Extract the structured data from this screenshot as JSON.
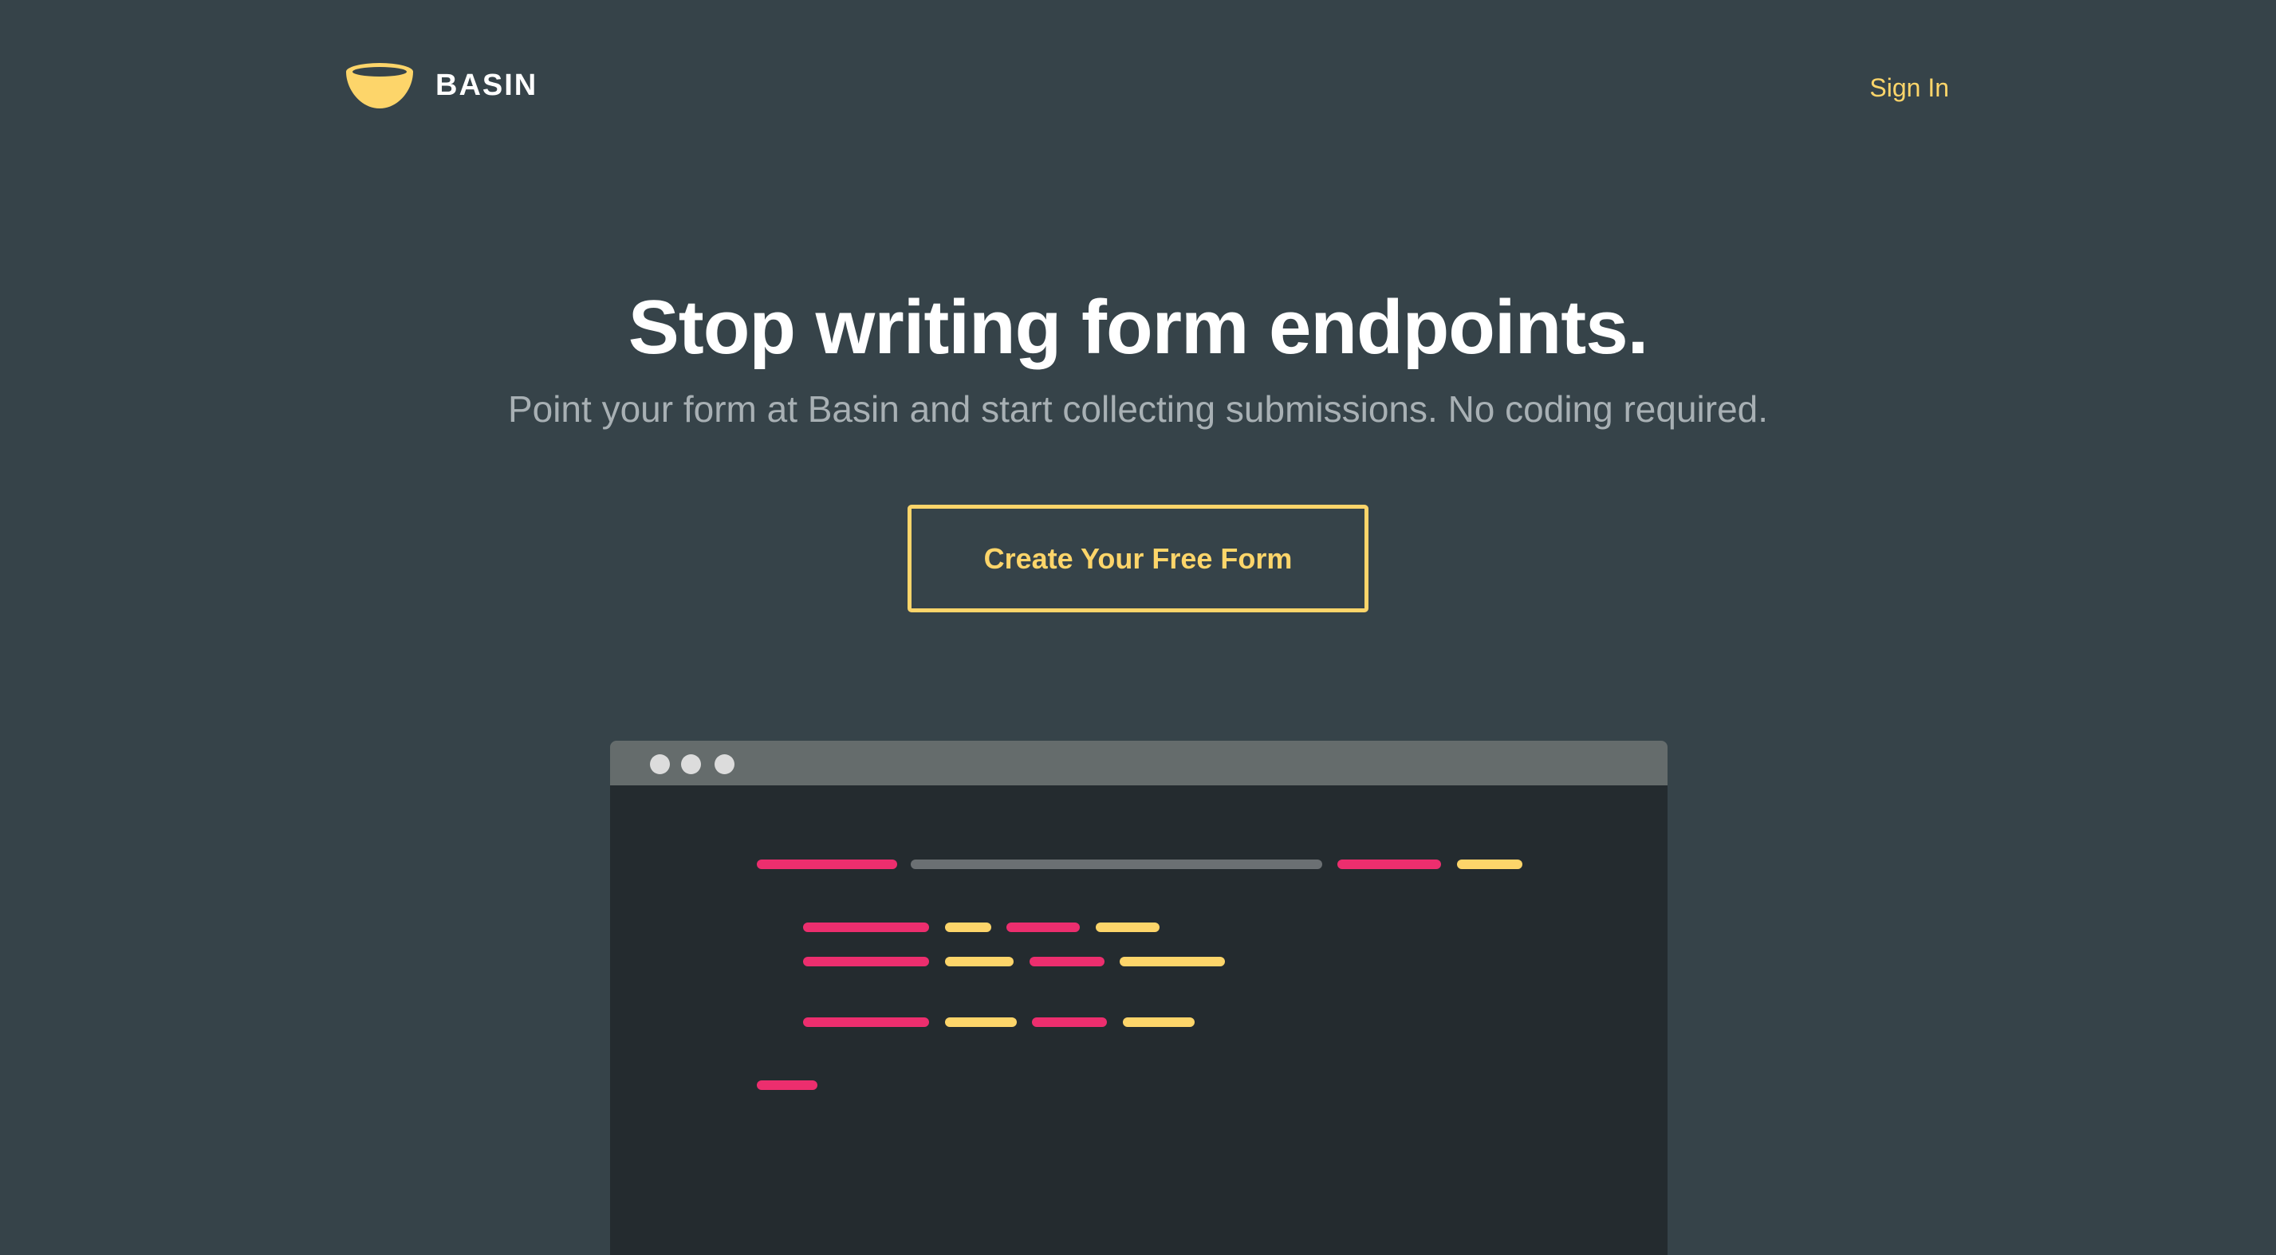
{
  "header": {
    "brand": "BASIN",
    "logo_icon": "bowl-icon",
    "sign_in_label": "Sign In"
  },
  "hero": {
    "title": "Stop writing form endpoints.",
    "subtitle": "Point your form at Basin and start collecting submissions. No coding required.",
    "cta_label": "Create Your Free Form"
  },
  "colors": {
    "background": "#364349",
    "accent": "#fdd56a",
    "code_pink": "#ec2e6e",
    "code_gray": "#6b7073",
    "editor_body": "#242b2f",
    "editor_bar": "#656c6c"
  }
}
